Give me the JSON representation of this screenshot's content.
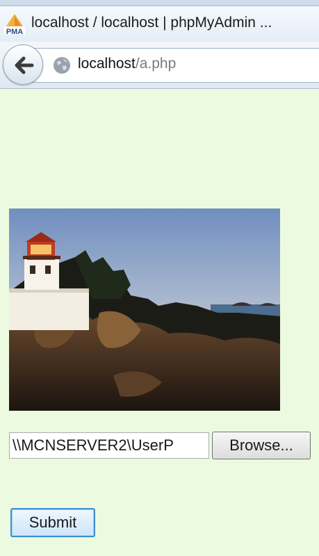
{
  "browser": {
    "tab_title": "localhost / localhost | phpMyAdmin ...",
    "favicon_text": "PMA",
    "url_host": "localhost",
    "url_path": "/a.php"
  },
  "form": {
    "file_path_value": "\\\\MCNSERVER2\\UserP",
    "browse_label": "Browse...",
    "submit_label": "Submit"
  },
  "colors": {
    "page_background": "#ecfbdf",
    "submit_border": "#3c8fd1"
  },
  "icons": [
    "pma-favicon-icon",
    "back-arrow-icon",
    "globe-icon"
  ]
}
